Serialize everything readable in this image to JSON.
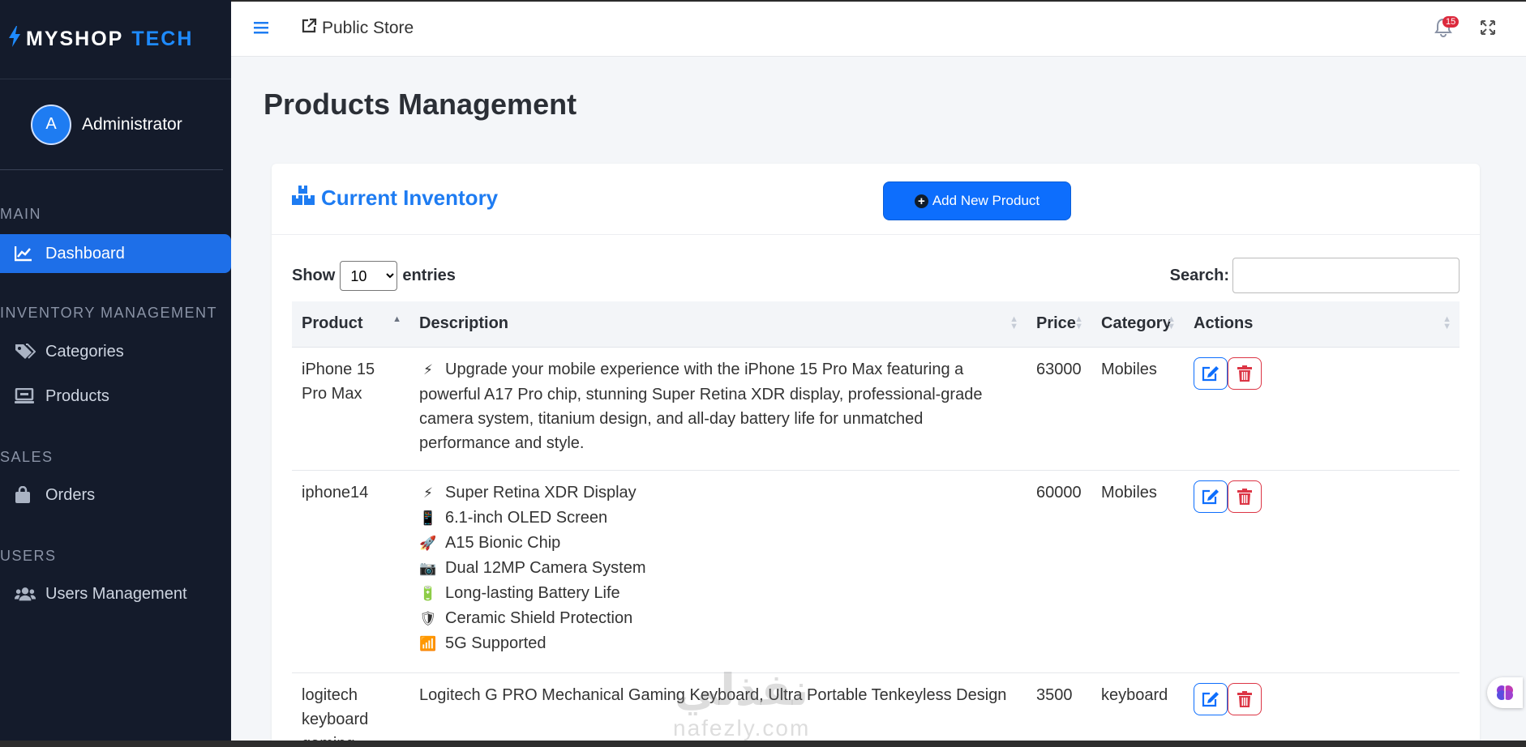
{
  "brand": {
    "part1": "MYSHOP",
    "part2": "TECH"
  },
  "user": {
    "initial": "A",
    "name": "Administrator"
  },
  "sidebar": {
    "sections": [
      "MAIN",
      "INVENTORY MANAGEMENT",
      "SALES",
      "USERS"
    ],
    "items": [
      {
        "label": "Dashboard",
        "icon": "chart-line-icon",
        "active": true
      },
      {
        "label": "Categories",
        "icon": "tags-icon"
      },
      {
        "label": "Products",
        "icon": "laptop-icon"
      },
      {
        "label": "Orders",
        "icon": "shopping-bag-icon"
      },
      {
        "label": "Users Management",
        "icon": "users-icon"
      }
    ]
  },
  "topbar": {
    "public_store": "Public Store",
    "notification_count": "15"
  },
  "page": {
    "title": "Products Management"
  },
  "card": {
    "title": "Current Inventory",
    "add_button": "Add New Product"
  },
  "table_controls": {
    "show_label": "Show",
    "entries_label": "entries",
    "page_size": "10",
    "search_label": "Search:"
  },
  "table": {
    "headers": [
      "Product",
      "Description",
      "Price",
      "Category",
      "Actions"
    ],
    "rows": [
      {
        "product": "iPhone 15 Pro Max",
        "description_lines": [
          {
            "emoji": "⚡",
            "text": "Upgrade your mobile experience with the iPhone 15 Pro Max featuring a powerful A17 Pro chip, stunning Super Retina XDR display, professional-grade camera system, titanium design, and all-day battery life for unmatched performance and style."
          }
        ],
        "price": "63000",
        "category": "Mobiles"
      },
      {
        "product": "iphone14",
        "description_lines": [
          {
            "emoji": "⚡",
            "text": "Super Retina XDR Display"
          },
          {
            "emoji": "📱",
            "text": "6.1-inch OLED Screen"
          },
          {
            "emoji": "🚀",
            "text": "A15 Bionic Chip"
          },
          {
            "emoji": "📷",
            "text": "Dual 12MP Camera System"
          },
          {
            "emoji": "🔋",
            "text": "Long-lasting Battery Life"
          },
          {
            "emoji": "🛡",
            "text": "Ceramic Shield Protection"
          },
          {
            "emoji": "📶",
            "text": "5G Supported"
          }
        ],
        "price": "60000",
        "category": "Mobiles"
      },
      {
        "product": "logitech keyboard gaming",
        "description_lines": [
          {
            "emoji": "",
            "text": "Logitech G PRO Mechanical Gaming Keyboard, Ultra Portable Tenkeyless Design"
          }
        ],
        "price": "3500",
        "category": "keyboard"
      }
    ]
  },
  "watermark": {
    "arabic": "نفذلي",
    "latin": "nafezly.com"
  },
  "colors": {
    "sidebar_bg": "#141b2b",
    "accent": "#1e7cf2",
    "primary_button": "#0d6efd",
    "danger": "#dc3545"
  }
}
